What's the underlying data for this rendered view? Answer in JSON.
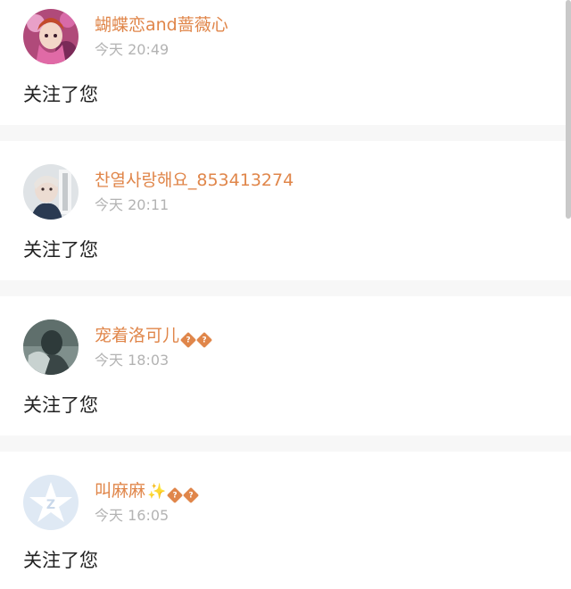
{
  "notifications": [
    {
      "username": "蝴蝶恋and蔷薇心",
      "time": "今天 20:49",
      "message": "关注了您",
      "avatar": "anime-girl-avatar",
      "badges": []
    },
    {
      "username": "찬열사랑해요_853413274",
      "time": "今天 20:11",
      "message": "关注了您",
      "avatar": "person-photo-avatar",
      "badges": []
    },
    {
      "username": "宠着洛可儿",
      "time": "今天 18:03",
      "message": "关注了您",
      "avatar": "dark-photo-avatar",
      "badges": [
        "?",
        "?"
      ]
    },
    {
      "username": "叫麻麻",
      "time": "今天 16:05",
      "message": "关注了您",
      "avatar": "default-z-avatar",
      "sparkle": "✨",
      "badges": [
        "?",
        "?"
      ]
    }
  ],
  "colors": {
    "username": "#e0864a",
    "time": "#b3b3b3",
    "message": "#222222",
    "separator": "#f7f7f7"
  }
}
